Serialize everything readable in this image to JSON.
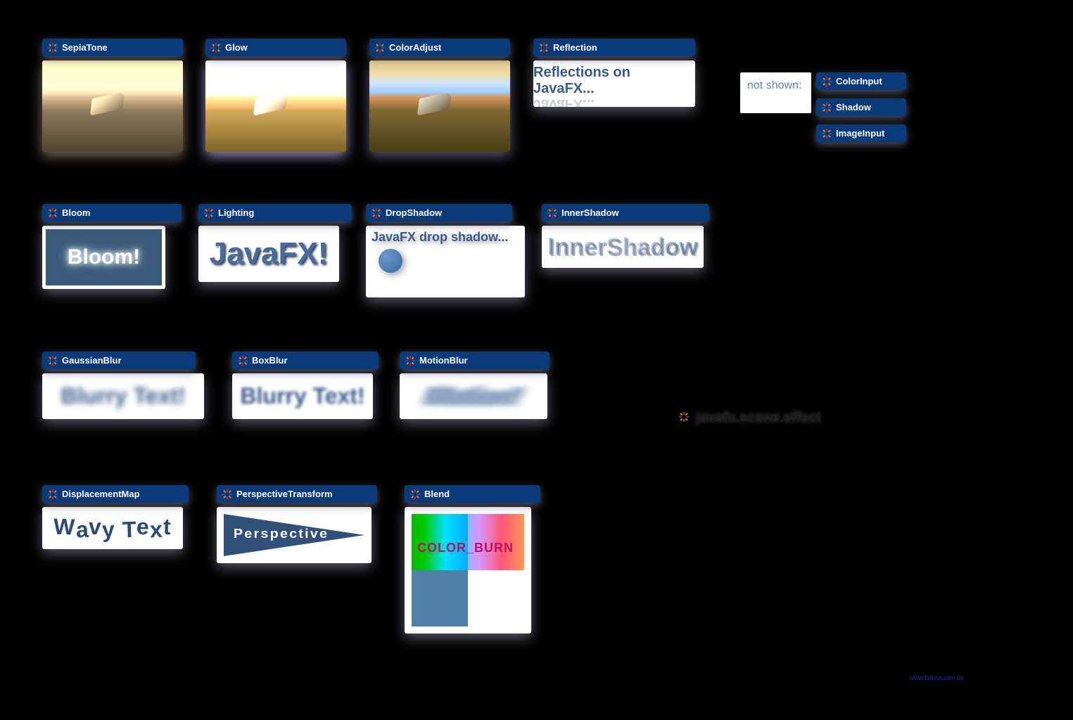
{
  "row1": {
    "sepiatone": "SepiaTone",
    "glow": "Glow",
    "coloradjust": "ColorAdjust",
    "reflection": "Reflection",
    "reflection_text": "Reflections on JavaFX..."
  },
  "notshown_label": "not shown:",
  "notshown": {
    "colorinput": "ColorInput",
    "shadow": "Shadow",
    "imageinput": "ImageInput"
  },
  "row2": {
    "bloom": "Bloom",
    "bloom_text": "Bloom!",
    "lighting": "Lighting",
    "lighting_text": "JavaFX!",
    "dropshadow": "DropShadow",
    "dropshadow_text": "JavaFX drop shadow...",
    "innershadow": "InnerShadow",
    "innershadow_text": "InnerShadow"
  },
  "row3": {
    "gaussianblur": "GaussianBlur",
    "gaussian_text": "Blurry Text!",
    "boxblur": "BoxBlur",
    "box_text": "Blurry Text!",
    "motionblur": "MotionBlur",
    "motion_text": "Motion!"
  },
  "row4": {
    "displacement": "DisplacementMap",
    "displacement_text": "Wavy Text",
    "perspective": "PerspectiveTransform",
    "perspective_text": "Perspective",
    "blend": "Blend",
    "blend_text": "COLOR_BURN"
  },
  "package": "javafx.scene.effect",
  "footer": "www.falkhausen.de"
}
